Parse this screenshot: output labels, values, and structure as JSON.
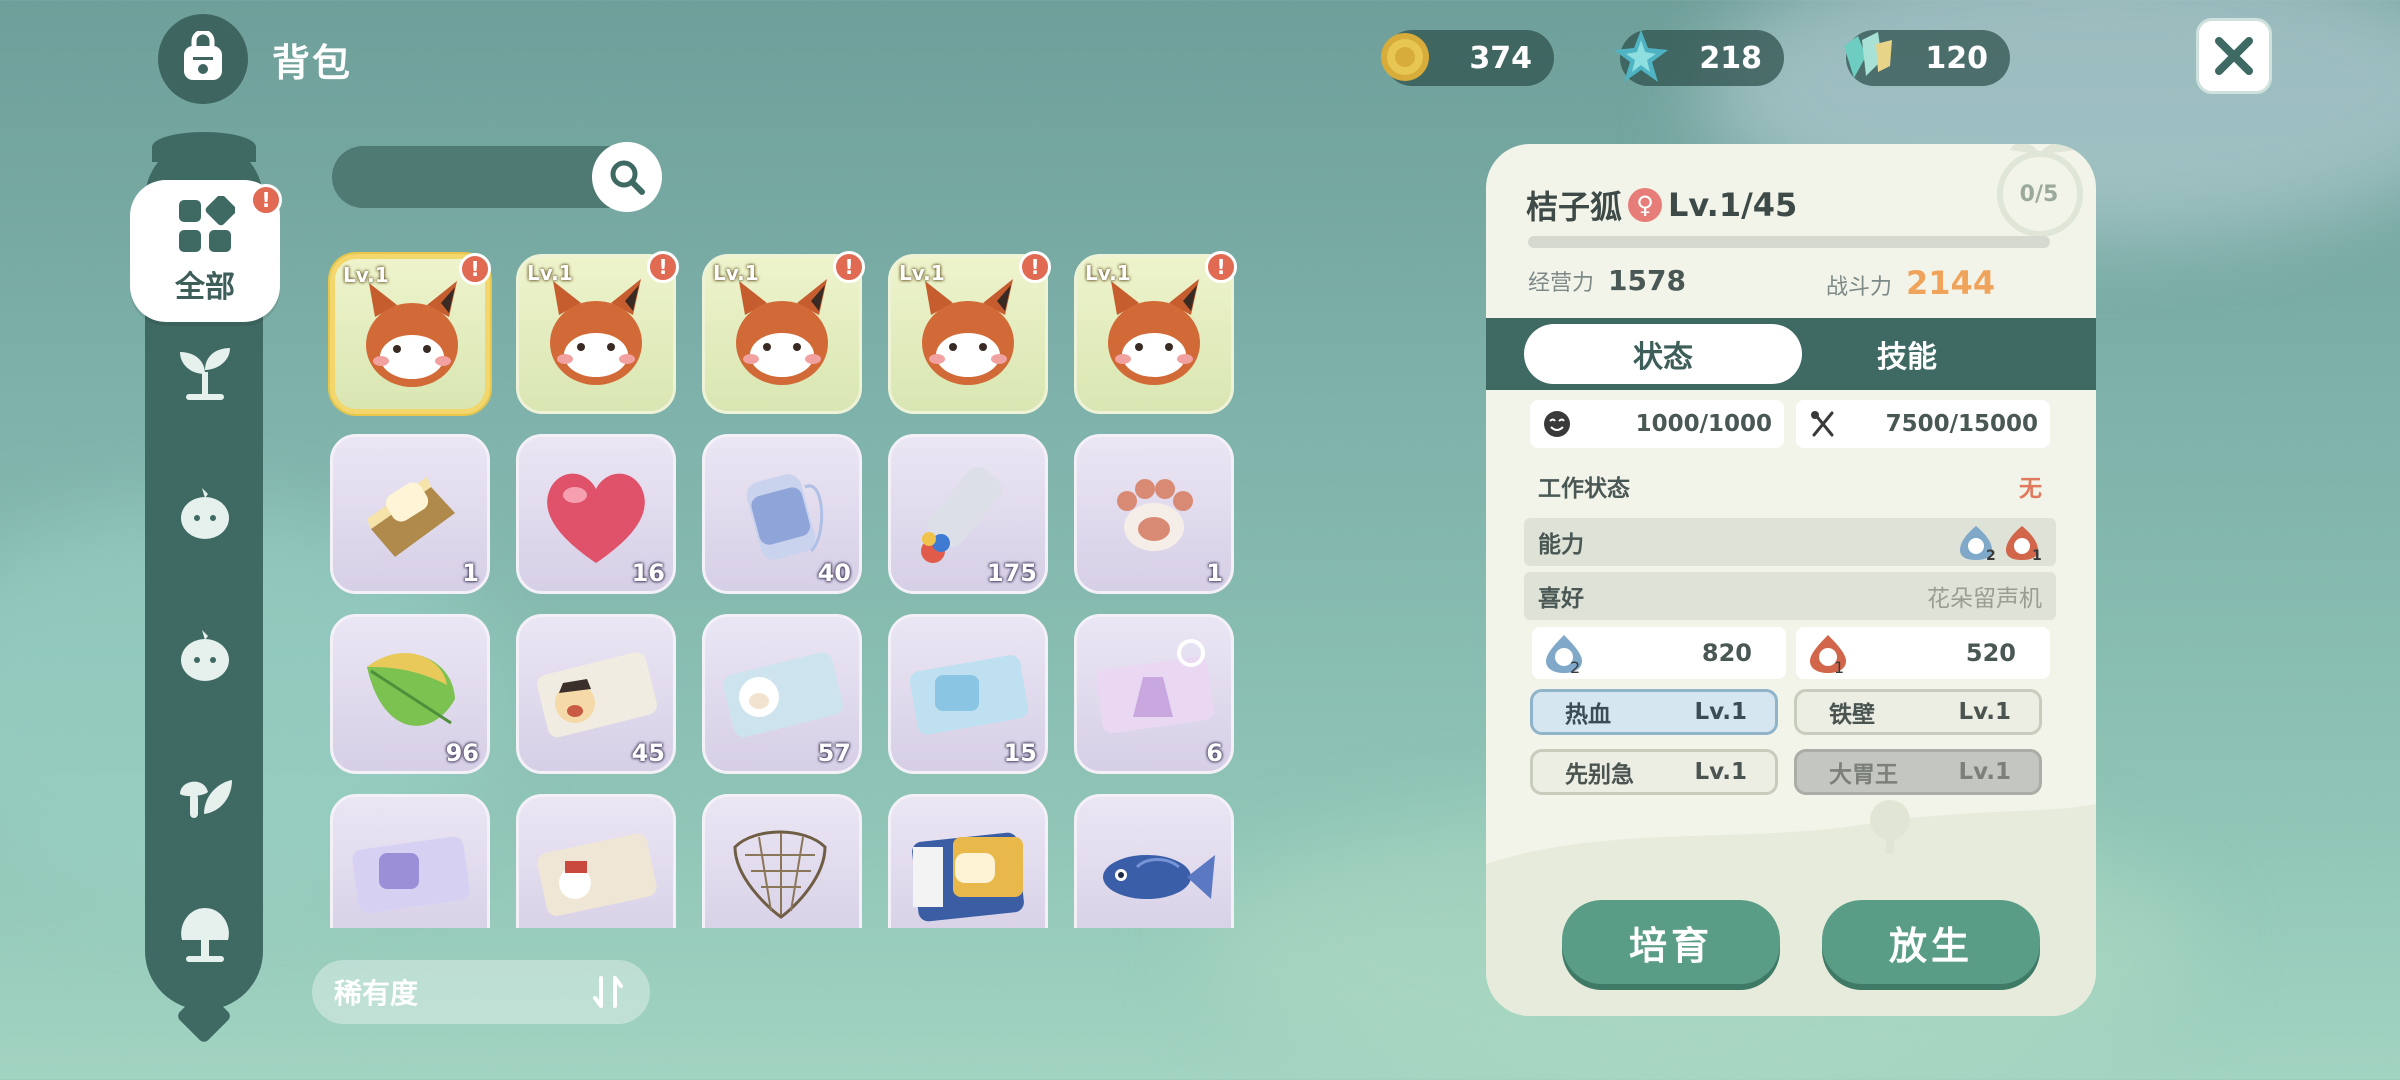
{
  "header": {
    "title": "背包",
    "icon": "backpack-icon"
  },
  "currencies": [
    {
      "name": "gold-coin-icon",
      "value": "374"
    },
    {
      "name": "star-crystal-icon",
      "value": "218"
    },
    {
      "name": "gem-cluster-icon",
      "value": "120"
    }
  ],
  "sidebar": {
    "active_label": "全部",
    "items": [
      {
        "name": "all",
        "label": "全部",
        "alert": "!"
      },
      {
        "name": "sprout",
        "icon": "sprout-icon"
      },
      {
        "name": "creature-a",
        "icon": "creature-icon"
      },
      {
        "name": "creature-b",
        "icon": "creature-icon"
      },
      {
        "name": "mushroom-leaf",
        "icon": "mushroom-leaf-icon"
      },
      {
        "name": "tree",
        "icon": "tree-icon"
      }
    ]
  },
  "search": {
    "placeholder": ""
  },
  "grid": {
    "pets": [
      {
        "level": "Lv.1",
        "alert": "!",
        "selected": true
      },
      {
        "level": "Lv.1",
        "alert": "!"
      },
      {
        "level": "Lv.1",
        "alert": "!"
      },
      {
        "level": "Lv.1",
        "alert": "!"
      },
      {
        "level": "Lv.1",
        "alert": "!"
      }
    ],
    "items_row2": [
      {
        "icon": "cat-box-icon",
        "count": "1"
      },
      {
        "icon": "heart-icon",
        "count": "16"
      },
      {
        "icon": "yarn-bobbin-icon",
        "count": "40"
      },
      {
        "icon": "paint-tube-icon",
        "count": "175"
      },
      {
        "icon": "paw-icon",
        "count": "1"
      }
    ],
    "items_row3": [
      {
        "icon": "leaf-icon",
        "count": "96"
      },
      {
        "icon": "ticket-face-icon",
        "count": "45"
      },
      {
        "icon": "ticket-sheep-icon",
        "count": "57"
      },
      {
        "icon": "ticket-sofa-icon",
        "count": "15"
      },
      {
        "icon": "ticket-dress-icon",
        "count": "6"
      }
    ],
    "items_row4": [
      {
        "icon": "ticket-chair-icon"
      },
      {
        "icon": "ticket-hat-icon"
      },
      {
        "icon": "net-icon"
      },
      {
        "icon": "card-sofa-icon"
      },
      {
        "icon": "fish-icon"
      }
    ]
  },
  "sort": {
    "label": "稀有度"
  },
  "pet_panel": {
    "name": "桔子狐",
    "gender_symbol": "♀",
    "level": "Lv.1/45",
    "badge": "0/5",
    "exp_fill": 0,
    "stats": [
      {
        "label": "经营力",
        "value": "1578",
        "color": "#4a5855"
      },
      {
        "label": "战斗力",
        "value": "2144",
        "color": "#f0a35a"
      }
    ],
    "tabs": [
      "状态",
      "技能"
    ],
    "mood": "1000/1000",
    "food": "7500/15000",
    "work_status": {
      "label": "工作状态",
      "value": "无"
    },
    "ability": {
      "label": "能力",
      "levels": [
        "2",
        "1"
      ]
    },
    "favorite": {
      "label": "喜好",
      "value": "花朵留声机"
    },
    "ability_values": [
      {
        "icon": "water-ability-icon",
        "level": "2",
        "value": "820"
      },
      {
        "icon": "fire-ability-icon",
        "level": "1",
        "value": "520"
      }
    ],
    "traits": [
      {
        "name": "热血",
        "level": "Lv.1",
        "style": "blue"
      },
      {
        "name": "铁壁",
        "level": "Lv.1",
        "style": "beige"
      },
      {
        "name": "先别急",
        "level": "Lv.1",
        "style": "beige"
      },
      {
        "name": "大胃王",
        "level": "Lv.1",
        "style": "gray"
      }
    ],
    "buttons": {
      "raise": "培育",
      "release": "放生"
    }
  }
}
